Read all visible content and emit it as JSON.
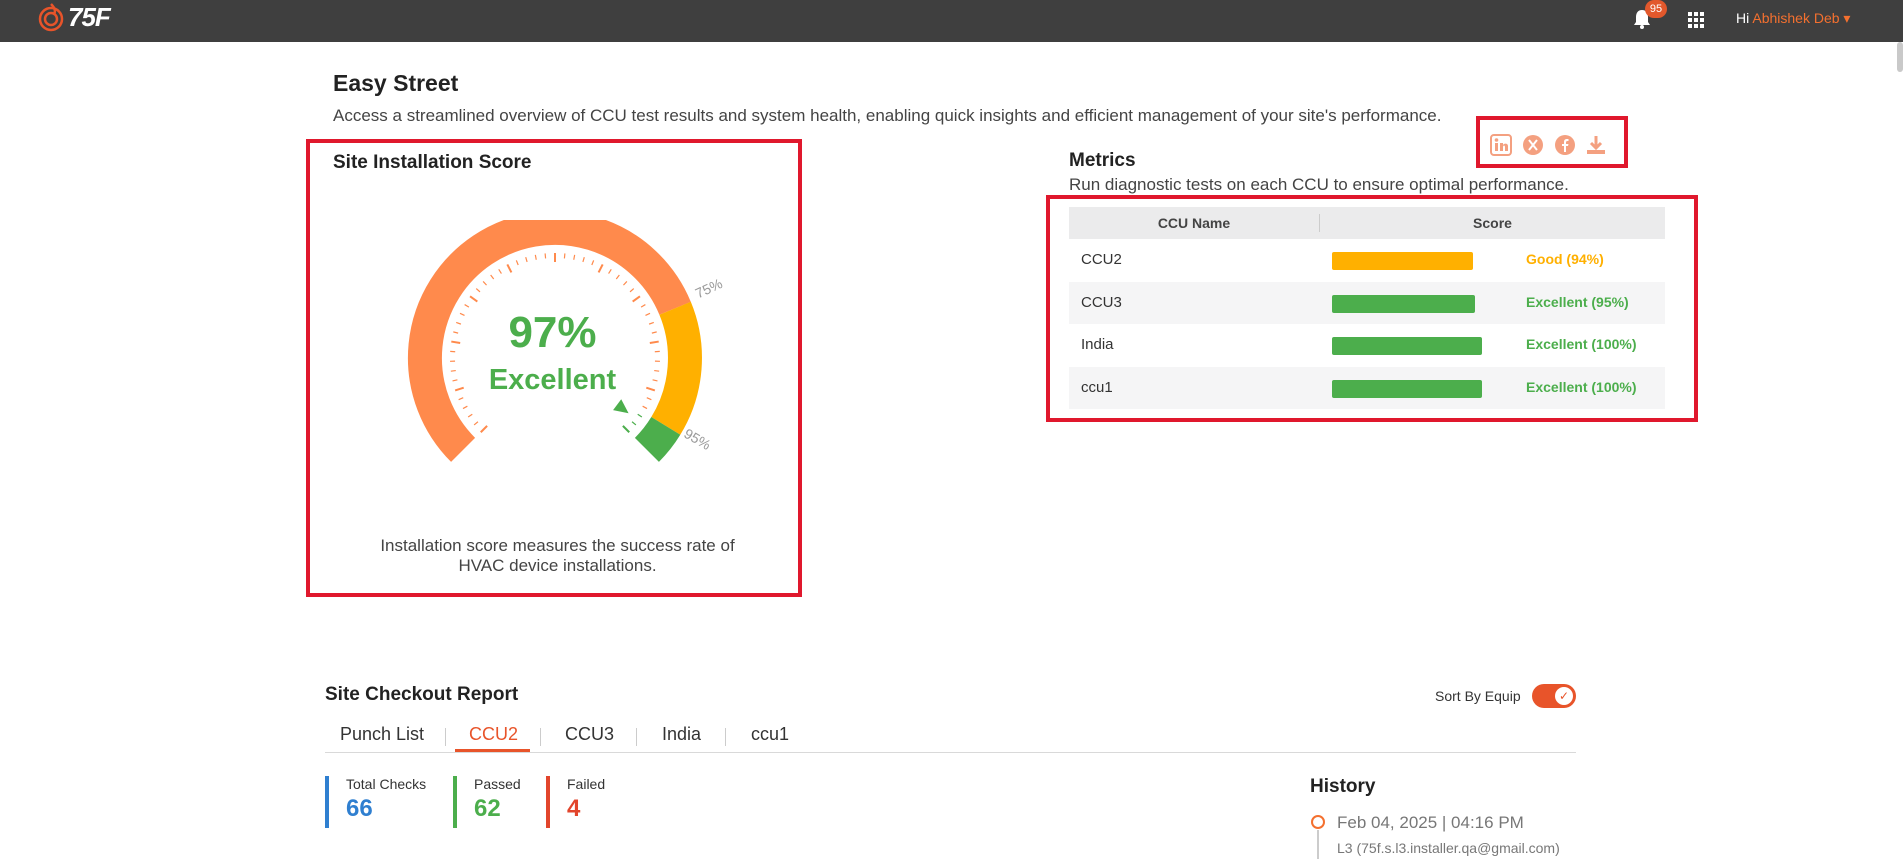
{
  "header": {
    "brand": "75F",
    "notification_count": "95",
    "greeting": "Hi",
    "user_name": "Abhishek Deb"
  },
  "page": {
    "title": "Easy Street",
    "description": "Access a streamlined overview of CCU test results and system health, enabling quick insights and efficient management of your site's performance."
  },
  "score_card": {
    "title": "Site Installation Score",
    "score": "97%",
    "score_value": 97,
    "rating": "Excellent",
    "mark_75": "75%",
    "mark_95": "95%",
    "note": "Installation score measures the success rate of HVAC device installations."
  },
  "metrics": {
    "title": "Metrics",
    "description": "Run diagnostic tests on each CCU to ensure optimal performance.",
    "columns": [
      "CCU Name",
      "Score"
    ],
    "rows": [
      {
        "name": "CCU2",
        "score": "Good (94%)",
        "percent": 94,
        "color": "#ffb000"
      },
      {
        "name": "CCU3",
        "score": "Excellent (95%)",
        "percent": 95,
        "color": "#4cae4c"
      },
      {
        "name": "India",
        "score": "Excellent (100%)",
        "percent": 100,
        "color": "#4cae4c"
      },
      {
        "name": "ccu1",
        "score": "Excellent (100%)",
        "percent": 100,
        "color": "#4cae4c"
      }
    ]
  },
  "share_icons": [
    "linkedin-icon",
    "x-icon",
    "facebook-icon",
    "download-icon"
  ],
  "checkout": {
    "title": "Site Checkout Report",
    "sort_label": "Sort By Equip",
    "tabs": [
      "Punch List",
      "CCU2",
      "CCU3",
      "India",
      "ccu1"
    ],
    "active_tab": "CCU2",
    "stats": [
      {
        "label": "Total Checks",
        "value": "66",
        "color": "#2f7fd0"
      },
      {
        "label": "Passed",
        "value": "62",
        "color": "#4cae4c"
      },
      {
        "label": "Failed",
        "value": "4",
        "color": "#e2452c"
      }
    ]
  },
  "history": {
    "title": "History",
    "entries": [
      {
        "date": "Feb 04, 2025 | 04:16 PM",
        "user": "L3 (75f.s.l3.installer.qa@gmail.com)"
      }
    ]
  },
  "colors": {
    "accent": "#e8542a",
    "excellent": "#4cae4c",
    "good": "#ffb000",
    "gauge_low": "#ff8a4c"
  }
}
